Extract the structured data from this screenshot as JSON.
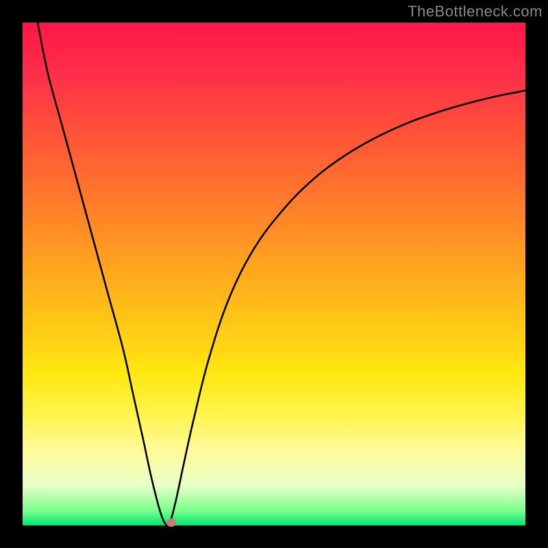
{
  "watermark": "TheBottleneck.com",
  "chart_data": {
    "type": "line",
    "title": "",
    "xlabel": "",
    "ylabel": "",
    "xlim": [
      0,
      100
    ],
    "ylim": [
      0,
      100
    ],
    "series": [
      {
        "name": "bottleneck-curve",
        "x": [
          3,
          5,
          8,
          11,
          14,
          17,
          20,
          22,
          24,
          25.5,
          27,
          28,
          28.8,
          29.3,
          30.5,
          32,
          34,
          37,
          41,
          46,
          52,
          58,
          64,
          70,
          76,
          82,
          88,
          94,
          100
        ],
        "values": [
          100,
          90,
          79,
          68,
          57,
          46,
          35,
          26,
          17,
          10,
          4,
          1,
          0,
          0.5,
          5,
          12,
          21,
          33,
          45,
          55,
          63,
          69,
          73.5,
          77,
          79.8,
          82,
          83.8,
          85.3,
          86.5
        ]
      }
    ],
    "marker": {
      "name": "optimum-point",
      "x": 29.5,
      "y": 0.5,
      "color": "#c4806f"
    },
    "gradient_stops": [
      {
        "pos": 0,
        "color": "#ff1744"
      },
      {
        "pos": 50,
        "color": "#ffc816"
      },
      {
        "pos": 80,
        "color": "#fff44d"
      },
      {
        "pos": 100,
        "color": "#00e676"
      }
    ]
  }
}
